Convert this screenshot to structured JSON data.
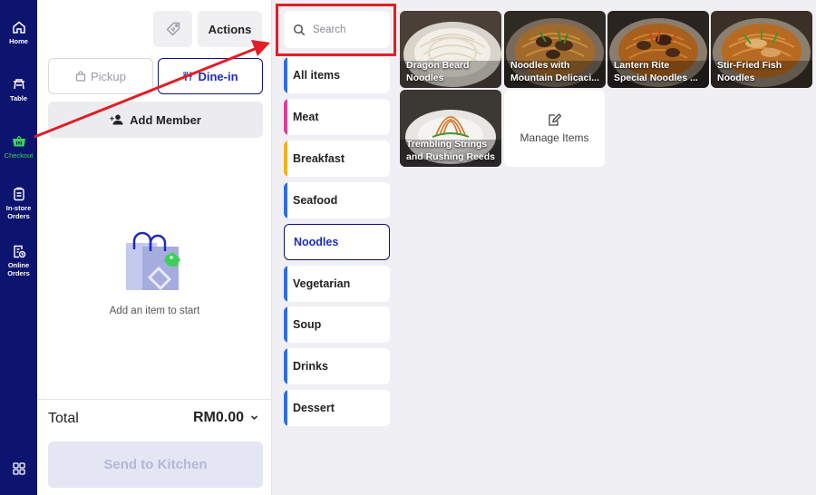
{
  "nav": {
    "items": [
      {
        "key": "home",
        "label": "Home",
        "icon": "home-icon"
      },
      {
        "key": "table",
        "label": "Table",
        "icon": "table-icon"
      },
      {
        "key": "checkout",
        "label": "Checkout",
        "icon": "basket-icon",
        "active": true
      },
      {
        "key": "instore",
        "label": "In-store\nOrders",
        "icon": "clipboard-icon"
      },
      {
        "key": "online",
        "label": "Online\nOrders",
        "icon": "online-order-icon"
      }
    ],
    "bottom_icon": "grid-icon"
  },
  "order": {
    "actions_label": "Actions",
    "discount_icon": "tag-icon",
    "pickup_label": "Pickup",
    "dinein_label": "Dine-in",
    "add_member_label": "Add Member",
    "empty_text": "Add an item to start",
    "total_label": "Total",
    "total_value": "RM0.00",
    "send_label": "Send to Kitchen"
  },
  "search": {
    "placeholder": "Search"
  },
  "categories": [
    {
      "label": "All items",
      "color": "#2f6fd8"
    },
    {
      "label": "Meat",
      "color": "#d9409a"
    },
    {
      "label": "Breakfast",
      "color": "#f0b21e"
    },
    {
      "label": "Seafood",
      "color": "#2f6fd8"
    },
    {
      "label": "Noodles",
      "color": "#2f6fd8",
      "active": true
    },
    {
      "label": "Vegetarian",
      "color": "#2f6fd8"
    },
    {
      "label": "Soup",
      "color": "#2f6fd8"
    },
    {
      "label": "Drinks",
      "color": "#2f6fd8"
    },
    {
      "label": "Dessert",
      "color": "#2f6fd8"
    }
  ],
  "items": [
    {
      "line1": "Dragon Beard",
      "line2": "Noodles"
    },
    {
      "line1": "Noodles with",
      "line2": "Mountain Delicaci..."
    },
    {
      "line1": "Lantern Rite",
      "line2": "Special Noodles ..."
    },
    {
      "line1": "Stir-Fried Fish",
      "line2": "Noodles"
    },
    {
      "line1": "Trembling Strings",
      "line2": "and Rushing Reeds"
    }
  ],
  "manage_items_label": "Manage Items",
  "colors": {
    "nav_bg": "#0d1470",
    "active_green": "#3fd05b",
    "accent_blue": "#1d2bbf",
    "highlight_red": "#e01f26"
  }
}
